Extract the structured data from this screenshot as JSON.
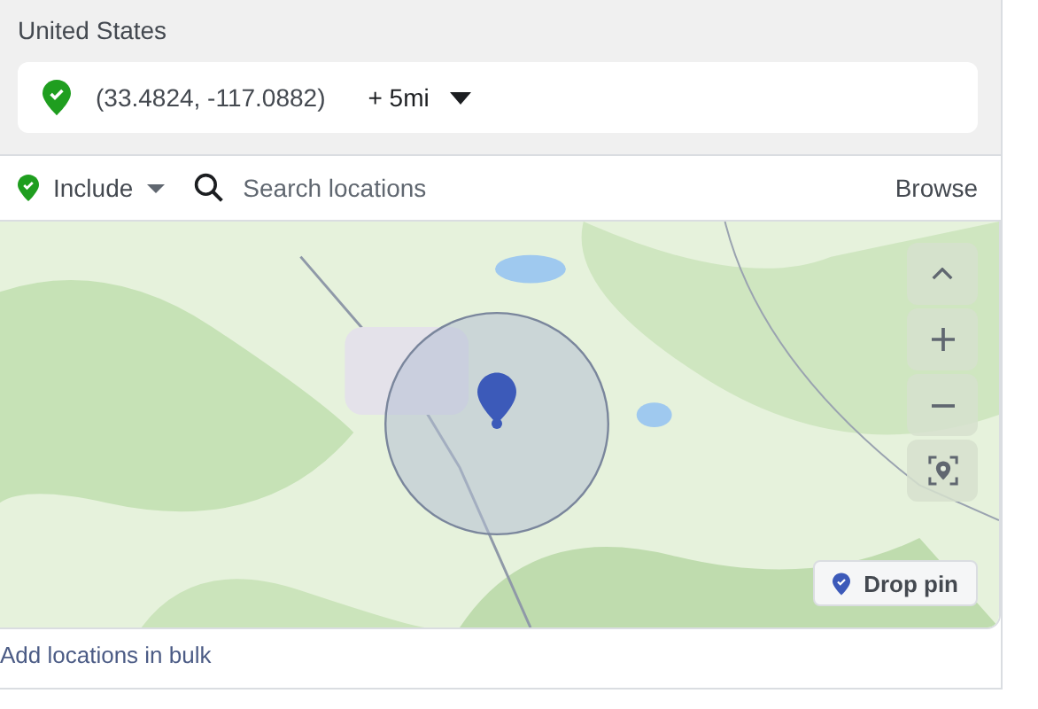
{
  "country": "United States",
  "location": {
    "coordinates": "(33.4824, -117.0882)",
    "radius": "+ 5mi"
  },
  "filter": {
    "mode": "Include",
    "search": {
      "placeholder": "Search locations"
    },
    "browse": "Browse"
  },
  "map": {
    "kind": "picture",
    "drop_pin": "Drop pin"
  },
  "bulk_link": "Add locations in bulk"
}
